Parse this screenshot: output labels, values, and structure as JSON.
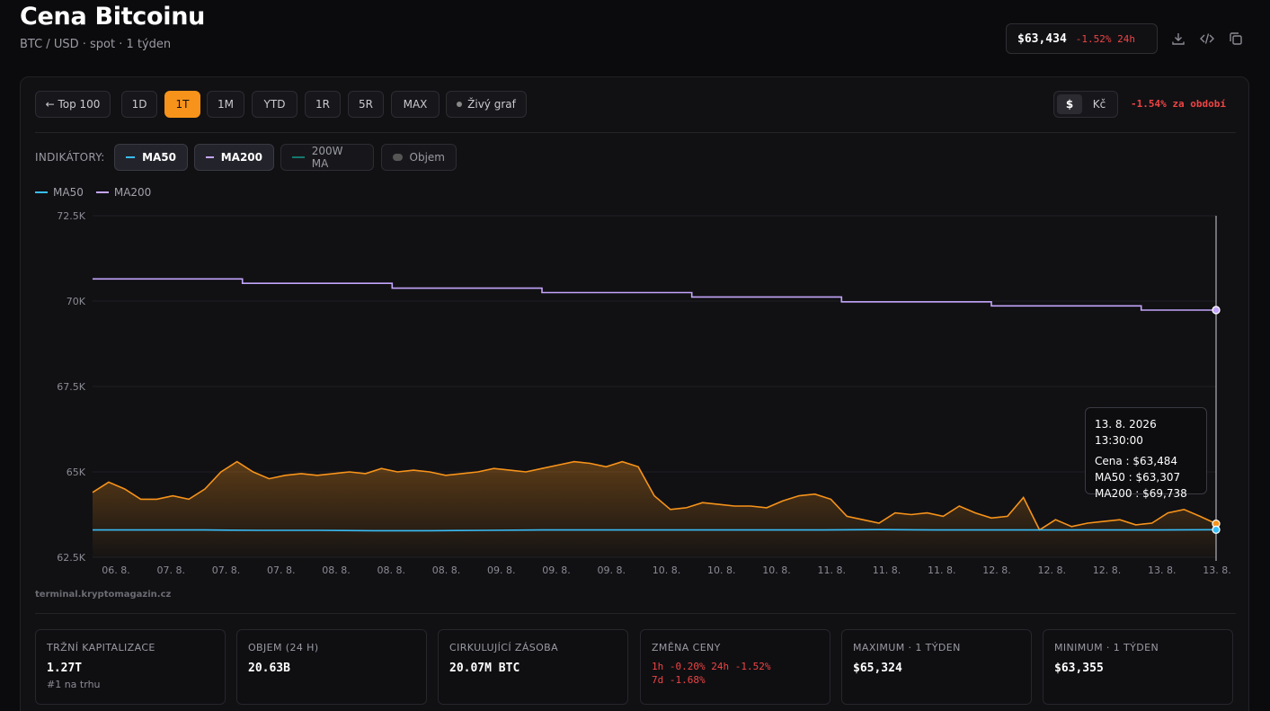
{
  "header": {
    "title": "Cena Bitcoinu",
    "subtitle": "BTC / USD · spot · 1 týden",
    "price": "$63,434",
    "change": "-1.52% 24h"
  },
  "toolbar": {
    "back": "← Top 100",
    "ranges": [
      "1D",
      "1T",
      "1M",
      "YTD",
      "1R",
      "5R",
      "MAX"
    ],
    "active_range": "1T",
    "live": "Živý graf",
    "currency_usd": "$",
    "currency_czk": "Kč",
    "period_change": "-1.54% za období"
  },
  "indicators": {
    "label": "INDIKÁTORY:",
    "ma50": "MA50",
    "ma200": "MA200",
    "ma200w": "200W MA",
    "volume": "Objem"
  },
  "legend": {
    "ma50": "MA50",
    "ma200": "MA200"
  },
  "colors": {
    "accent": "#f7931a",
    "ma50": "#38bdf8",
    "ma200": "#c4a5fb",
    "ma200w": "#14b8a6",
    "negative": "#ef4444"
  },
  "tooltip": {
    "date": "13. 8. 2026 13:30:00",
    "price": "Cena : $63,484",
    "ma50": "MA50 : $63,307",
    "ma200": "MA200 : $69,738"
  },
  "watermark": "terminal.kryptomagazin.cz",
  "chart_data": {
    "type": "line",
    "y_ticks": [
      "72.5K",
      "70K",
      "67.5K",
      "65K",
      "62.5K"
    ],
    "ylim": [
      62500,
      72500
    ],
    "x_ticks": [
      "06. 8.",
      "07. 8.",
      "07. 8.",
      "07. 8.",
      "08. 8.",
      "08. 8.",
      "08. 8.",
      "09. 8.",
      "09. 8.",
      "09. 8.",
      "10. 8.",
      "10. 8.",
      "10. 8.",
      "11. 8.",
      "11. 8.",
      "11. 8.",
      "12. 8.",
      "12. 8.",
      "12. 8.",
      "13. 8.",
      "13. 8."
    ],
    "series": [
      {
        "name": "Cena",
        "values": [
          64400,
          64700,
          64500,
          64200,
          64200,
          64300,
          64200,
          64500,
          65000,
          65300,
          65000,
          64800,
          64900,
          64950,
          64900,
          64950,
          65000,
          64950,
          65100,
          65000,
          65050,
          65000,
          64900,
          64950,
          65000,
          65100,
          65050,
          65000,
          65100,
          65200,
          65300,
          65250,
          65150,
          65300,
          65150,
          64300,
          63900,
          63950,
          64100,
          64050,
          64000,
          64000,
          63950,
          64150,
          64300,
          64350,
          64200,
          63700,
          63600,
          63500,
          63800,
          63750,
          63800,
          63700,
          64000,
          63800,
          63650,
          63700,
          64250,
          63300,
          63600,
          63400,
          63500,
          63550,
          63600,
          63450,
          63500,
          63800,
          63900,
          63700,
          63484
        ]
      },
      {
        "name": "MA50",
        "values": [
          63300,
          63300,
          63300,
          63290,
          63290,
          63280,
          63280,
          63290,
          63300,
          63300,
          63300,
          63300,
          63300,
          63300,
          63310,
          63300,
          63300,
          63300,
          63300,
          63300,
          63307
        ]
      },
      {
        "name": "MA200",
        "values": [
          70650,
          70650,
          70520,
          70520,
          70380,
          70380,
          70250,
          70250,
          70120,
          70120,
          69980,
          69980,
          69860,
          69860,
          69738,
          69738
        ]
      }
    ]
  },
  "stats": [
    {
      "label": "TRŽNÍ KAPITALIZACE",
      "value": "1.27T",
      "sub": "#1 na trhu"
    },
    {
      "label": "OBJEM (24 H)",
      "value": "20.63B"
    },
    {
      "label": "CIRKULUJÍCÍ ZÁSOBA",
      "value": "20.07M BTC"
    },
    {
      "label": "ZMĚNA CENY",
      "line1": "1h -0.20%  24h -1.52%",
      "line2": "7d -1.68%"
    },
    {
      "label": "MAXIMUM · 1 TÝDEN",
      "value": "$65,324"
    },
    {
      "label": "MINIMUM · 1 TÝDEN",
      "value": "$63,355"
    }
  ]
}
